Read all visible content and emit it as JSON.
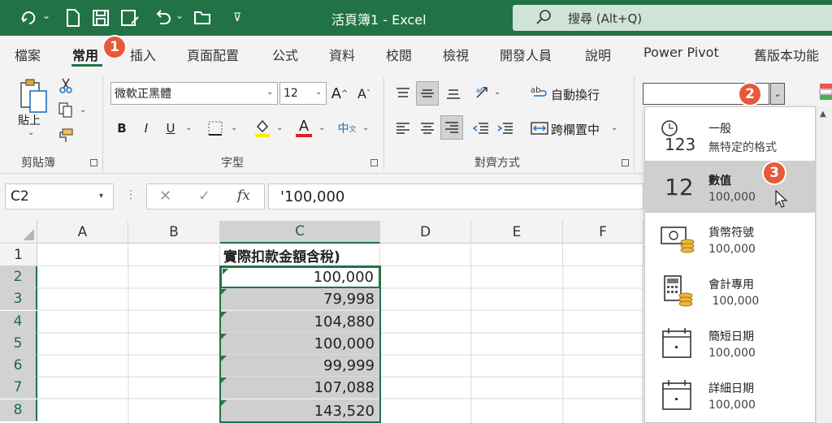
{
  "titlebar": {
    "title": "活頁簿1  -  Excel",
    "search_text": "搜尋 (Alt+Q)"
  },
  "menu": {
    "tabs": [
      "檔案",
      "常用",
      "插入",
      "頁面配置",
      "公式",
      "資料",
      "校閱",
      "檢視",
      "開發人員",
      "說明",
      "Power Pivot",
      "舊版本功能"
    ]
  },
  "callouts": [
    "1",
    "2",
    "3"
  ],
  "ribbon": {
    "clipboard": {
      "paste": "貼上",
      "label": "剪貼簿"
    },
    "font": {
      "name": "微軟正黑體",
      "size": "12",
      "bold": "B",
      "italic": "I",
      "underline": "U",
      "font_color": "A",
      "phonetic": "中",
      "grow": "A",
      "shrink": "A",
      "label": "字型"
    },
    "alignment": {
      "wrap": "自動換行",
      "merge": "跨欄置中",
      "label": "對齊方式"
    },
    "number_format_value": ""
  },
  "formula_bar": {
    "name_box": "C2",
    "cancel": "✕",
    "enter": "✓",
    "fx": "fx",
    "content": "'100,000"
  },
  "sheet": {
    "columns": [
      "A",
      "B",
      "C",
      "D",
      "E",
      "F"
    ],
    "rows": [
      "1",
      "2",
      "3",
      "4",
      "5",
      "6",
      "7",
      "8"
    ],
    "header_c1": "實際扣款金額含稅)",
    "values": [
      "100,000",
      "79,998",
      "104,880",
      "100,000",
      "99,999",
      "107,088",
      "143,520"
    ]
  },
  "number_format_menu": {
    "items": [
      {
        "name": "一般",
        "example": "無特定的格式",
        "icon": "clock-123-icon"
      },
      {
        "name": "數值",
        "example": "100,000",
        "icon": "number-12-icon"
      },
      {
        "name": "貨幣符號",
        "example": "100,000",
        "icon": "currency-icon"
      },
      {
        "name": "會計專用",
        "example": " 100,000",
        "icon": "accounting-icon"
      },
      {
        "name": "簡短日期",
        "example": "100,000",
        "icon": "short-date-icon"
      },
      {
        "name": "詳細日期",
        "example": "100,000",
        "icon": "long-date-icon"
      }
    ],
    "general_icon_digits": "123",
    "number_icon_digits": "12"
  },
  "colors": {
    "excel_green": "#217346",
    "callout": "#e8593a",
    "selection": "#cfcfcf"
  }
}
